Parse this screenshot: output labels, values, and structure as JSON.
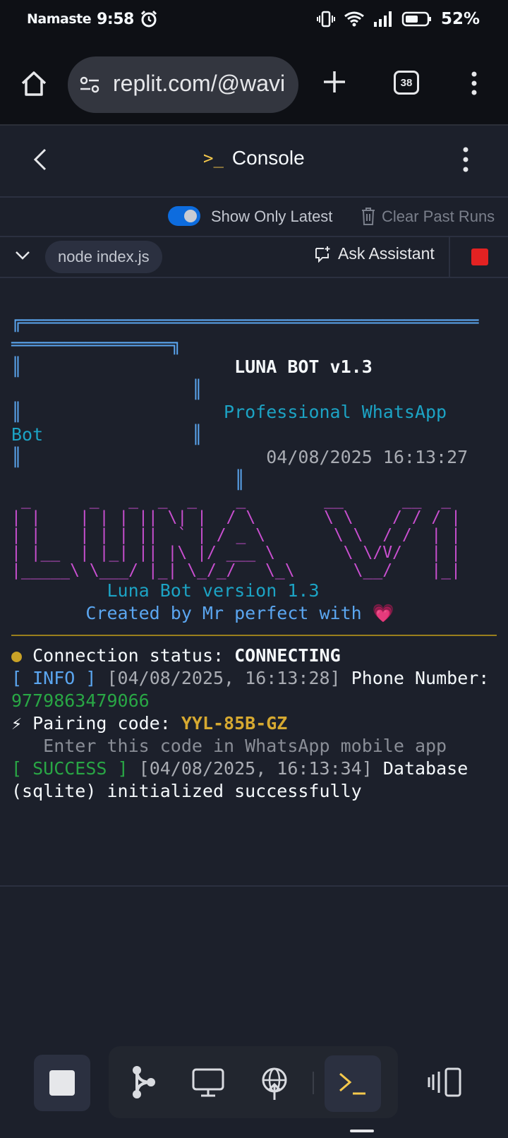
{
  "status_bar": {
    "carrier": "Namaste",
    "time": "9:58",
    "battery": "52%"
  },
  "browser": {
    "url": "replit.com/@wavi",
    "tab_count": "38"
  },
  "header": {
    "title": "Console"
  },
  "toolbar": {
    "toggle_label": "Show Only Latest",
    "toggle_on": true,
    "clear_label": "Clear Past Runs"
  },
  "run": {
    "command": "node index.js",
    "assistant_label": "Ask Assistant"
  },
  "console": {
    "banner_title": "LUNA BOT v1.3",
    "banner_sub_1": "Professional WhatsApp",
    "banner_sub_2": "Bot",
    "banner_date": "04/08/2025 16:13:27",
    "credit_1": "Luna Bot version 1.3",
    "credit_2": "Created by Mr perfect with 💗",
    "status_label": "Connection status:",
    "status_value": "CONNECTING",
    "info_tag": "[ INFO ]",
    "info_time": "[04/08/2025, 16:13:28]",
    "info_text": "Phone Number:",
    "phone": "9779863479066",
    "pair_label": "⚡ Pairing code:",
    "pair_code": "YYL-85B-GZ",
    "pair_hint": "   Enter this code in WhatsApp mobile app",
    "success_tag": "[ SUCCESS ]",
    "success_time": "[04/08/2025, 16:13:34]",
    "success_text": "Database (sqlite) initialized successfully"
  },
  "colors": {
    "accent_blue": "#0d6cde",
    "stop_red": "#e32222",
    "prompt_yellow": "#f6c94c",
    "ascii_magenta": "#c94fd0"
  }
}
